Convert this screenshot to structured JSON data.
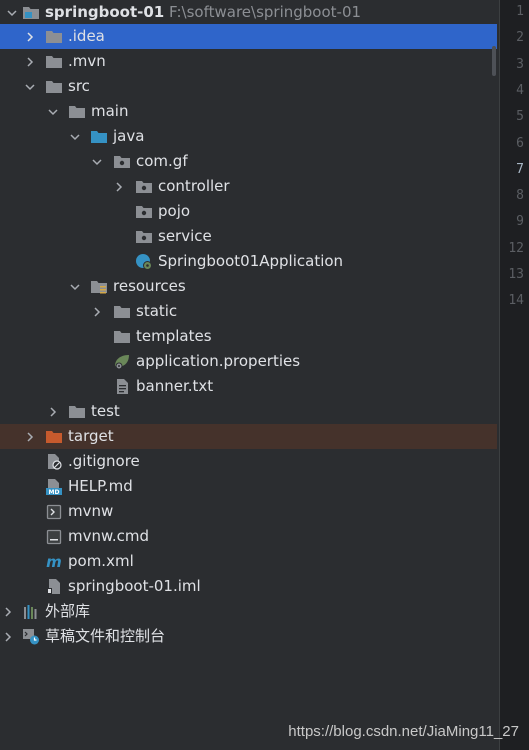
{
  "project": {
    "name": "springboot-01",
    "path": "F:\\software\\springboot-01"
  },
  "tree": {
    "idea": ".idea",
    "mvn": ".mvn",
    "src": "src",
    "main": "main",
    "java": "java",
    "package": "com.gf",
    "controller": "controller",
    "pojo": "pojo",
    "service": "service",
    "app_class": "Springboot01Application",
    "resources": "resources",
    "static": "static",
    "templates": "templates",
    "app_props": "application.properties",
    "banner": "banner.txt",
    "test": "test",
    "target": "target",
    "gitignore": ".gitignore",
    "help": "HELP.md",
    "mvnw": "mvnw",
    "mvnw_cmd": "mvnw.cmd",
    "pom": "pom.xml",
    "iml": "springboot-01.iml",
    "external_libs": "外部库",
    "scratches": "草稿文件和控制台"
  },
  "gutter": {
    "lines": [
      "1",
      "2",
      "3",
      "4",
      "5",
      "6",
      "7",
      "8",
      "9",
      "12",
      "13",
      "14"
    ],
    "current": "7"
  },
  "watermark": "https://blog.csdn.net/JiaMing11_27",
  "colors": {
    "background": "#2b2d30",
    "selection": "#2f65ca",
    "excluded": "#45322b",
    "folder": "#8c8f94",
    "source_folder": "#3592c4",
    "excluded_folder": "#c75a2d"
  }
}
